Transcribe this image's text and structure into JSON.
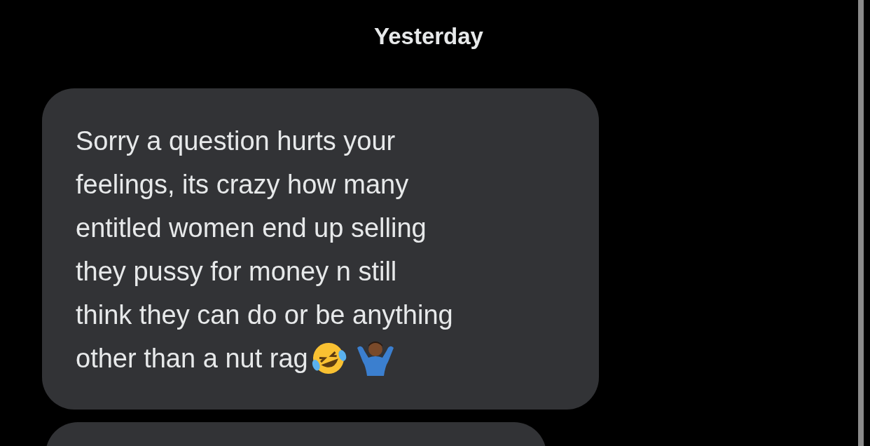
{
  "date_divider": "Yesterday",
  "messages": [
    {
      "kind": "text",
      "lines": [
        "Sorry a question hurts your",
        "feelings, its crazy how many",
        "entitled women end up selling",
        "they pussy for money n still",
        "think they can do or be anything",
        "other than a nut rag"
      ]
    },
    {
      "kind": "cut_off"
    }
  ]
}
